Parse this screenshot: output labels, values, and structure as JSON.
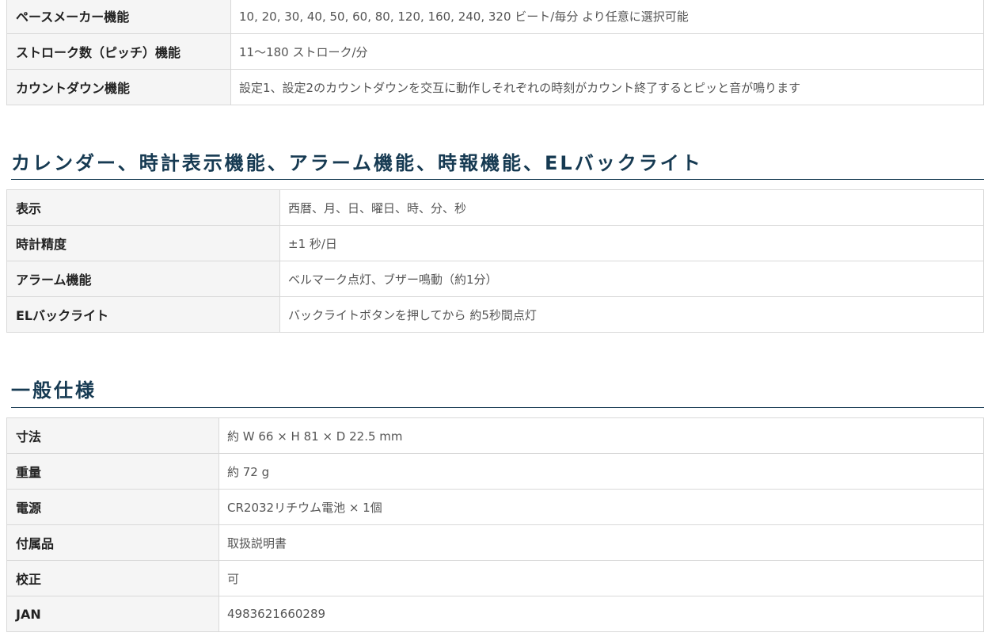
{
  "table_pacer": {
    "rows": [
      {
        "label": "ペースメーカー機能",
        "value": "10, 20, 30, 40, 50, 60, 80, 120, 160, 240, 320 ビート/毎分 より任意に選択可能"
      },
      {
        "label": "ストローク数（ピッチ）機能",
        "value": "11～180 ストローク/分"
      },
      {
        "label": "カウントダウン機能",
        "value": "設定1、設定2のカウントダウンを交互に動作しそれぞれの時刻がカウント終了するとピッと音が鳴ります"
      }
    ]
  },
  "section_calendar": {
    "title": "カレンダー、時計表示機能、アラーム機能、時報機能、ELバックライト",
    "rows": [
      {
        "label": "表示",
        "value": "西暦、月、日、曜日、時、分、秒"
      },
      {
        "label": "時計精度",
        "value": "±1 秒/日"
      },
      {
        "label": "アラーム機能",
        "value": "ベルマーク点灯、ブザー鳴動（約1分）"
      },
      {
        "label": "ELバックライト",
        "value": "バックライトボタンを押してから 約5秒間点灯"
      }
    ]
  },
  "section_general": {
    "title": "一般仕様",
    "rows": [
      {
        "label": "寸法",
        "value": "約 W 66 × H 81 × D 22.5 mm"
      },
      {
        "label": "重量",
        "value": "約 72 g"
      },
      {
        "label": "電源",
        "value": "CR2032リチウム電池 × 1個"
      },
      {
        "label": "付属品",
        "value": "取扱説明書"
      },
      {
        "label": "校正",
        "value": "可"
      },
      {
        "label": "JAN",
        "value": "4983621660289"
      }
    ]
  }
}
